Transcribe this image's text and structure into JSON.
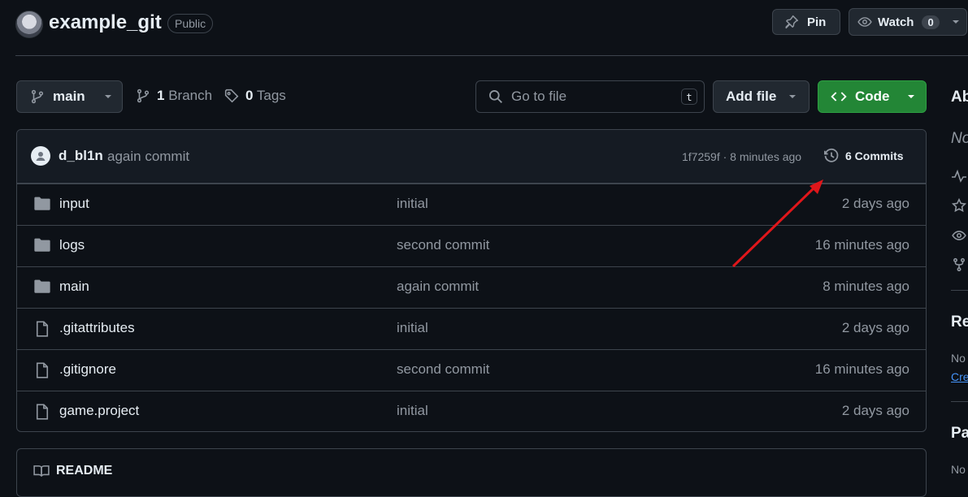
{
  "header": {
    "repo_name": "example_git",
    "visibility": "Public",
    "pin_label": "Pin",
    "watch_label": "Watch",
    "watch_count": "0"
  },
  "toolbar": {
    "branch": "main",
    "branch_count": "1",
    "branch_label": "Branch",
    "tag_count": "0",
    "tag_label": "Tags",
    "search_placeholder": "Go to file",
    "search_shortcut": "t",
    "add_file_label": "Add file",
    "code_label": "Code"
  },
  "latest_commit": {
    "author": "d_bl1n",
    "message": "again commit",
    "hash_time": "1f7259f · 8 minutes ago",
    "commits_label": "6 Commits"
  },
  "files": [
    {
      "name": "input",
      "type": "folder",
      "message": "initial",
      "time": "2 days ago"
    },
    {
      "name": "logs",
      "type": "folder",
      "message": "second commit",
      "time": "16 minutes ago"
    },
    {
      "name": "main",
      "type": "folder",
      "message": "again commit",
      "time": "8 minutes ago"
    },
    {
      "name": ".gitattributes",
      "type": "file",
      "message": "initial",
      "time": "2 days ago"
    },
    {
      "name": ".gitignore",
      "type": "file",
      "message": "second commit",
      "time": "16 minutes ago"
    },
    {
      "name": "game.project",
      "type": "file",
      "message": "initial",
      "time": "2 days ago"
    }
  ],
  "readme": {
    "title": "README"
  },
  "sidebar": {
    "about_heading": "Ab",
    "about_desc": "No",
    "releases_heading": "Re",
    "releases_text": "No",
    "releases_link": "Cre",
    "packages_heading": "Pa",
    "packages_text": "No"
  },
  "annotation": {
    "color": "#e0161a"
  }
}
